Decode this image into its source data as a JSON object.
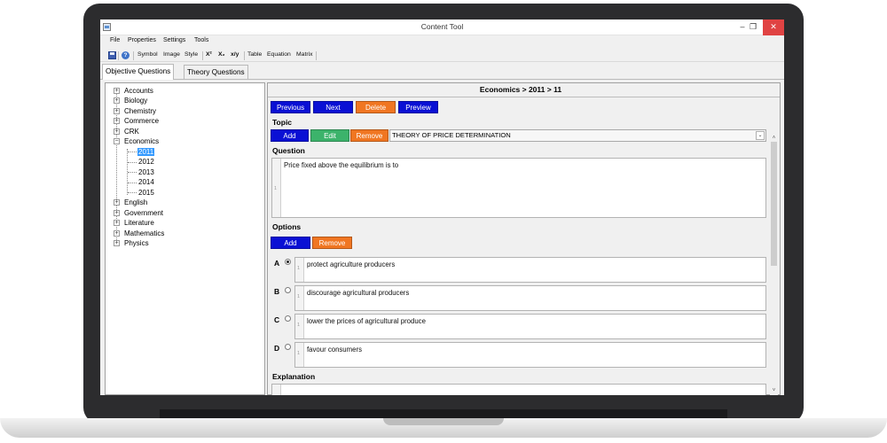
{
  "window": {
    "title": "Content Tool",
    "minimize": "–",
    "maximize": "❐",
    "close": "✕"
  },
  "menu": [
    "File",
    "Properties",
    "Settings",
    "Tools"
  ],
  "toolbar": {
    "symbol": "Symbol",
    "image": "Image",
    "style": "Style",
    "superscript": "X²",
    "subscript": "X₂",
    "fraction": "x/y",
    "table": "Table",
    "equation": "Equation",
    "matrix": "Matrix",
    "help_glyph": "?"
  },
  "tabs": [
    "Objective Questions",
    "Theory Questions"
  ],
  "tree": {
    "subjects": [
      "Accounts",
      "Biology",
      "Chemistry",
      "Commerce",
      "CRK",
      "Economics",
      "English",
      "Government",
      "Literature",
      "Mathematics",
      "Physics"
    ],
    "economics_years": [
      "2011",
      "2012",
      "2013",
      "2014",
      "2015"
    ],
    "selected_year": "2011",
    "expand_glyph": "+",
    "collapse_glyph": "−"
  },
  "breadcrumb": "Economics > 2011 > 11",
  "nav": {
    "previous": "Previous",
    "next": "Next",
    "delete": "Delete",
    "preview": "Preview"
  },
  "topic": {
    "label": "Topic",
    "add": "Add",
    "edit": "Edit",
    "remove": "Remove",
    "selected": "THEORY OF PRICE DETERMINATION",
    "dropdown_glyph": "⌄"
  },
  "question": {
    "label": "Question",
    "line_number": "1",
    "text": "Price fixed above the equilibrium is to"
  },
  "options": {
    "label": "Options",
    "add": "Add",
    "remove": "Remove",
    "items": [
      {
        "letter": "A",
        "line_number": "1",
        "text": "protect agriculture producers"
      },
      {
        "letter": "B",
        "line_number": "1",
        "text": "discourage agricultural producers"
      },
      {
        "letter": "C",
        "line_number": "1",
        "text": "lower the prices of agricultural produce"
      },
      {
        "letter": "D",
        "line_number": "1",
        "text": "favour consumers"
      }
    ],
    "selected": "A"
  },
  "explanation": {
    "label": "Explanation"
  },
  "scroll": {
    "up": "˄",
    "down": "˅"
  },
  "colors": {
    "blue_button": "#0a10d4",
    "orange_button": "#f07622",
    "green_button": "#3cb36b",
    "selection": "#3399ff"
  }
}
